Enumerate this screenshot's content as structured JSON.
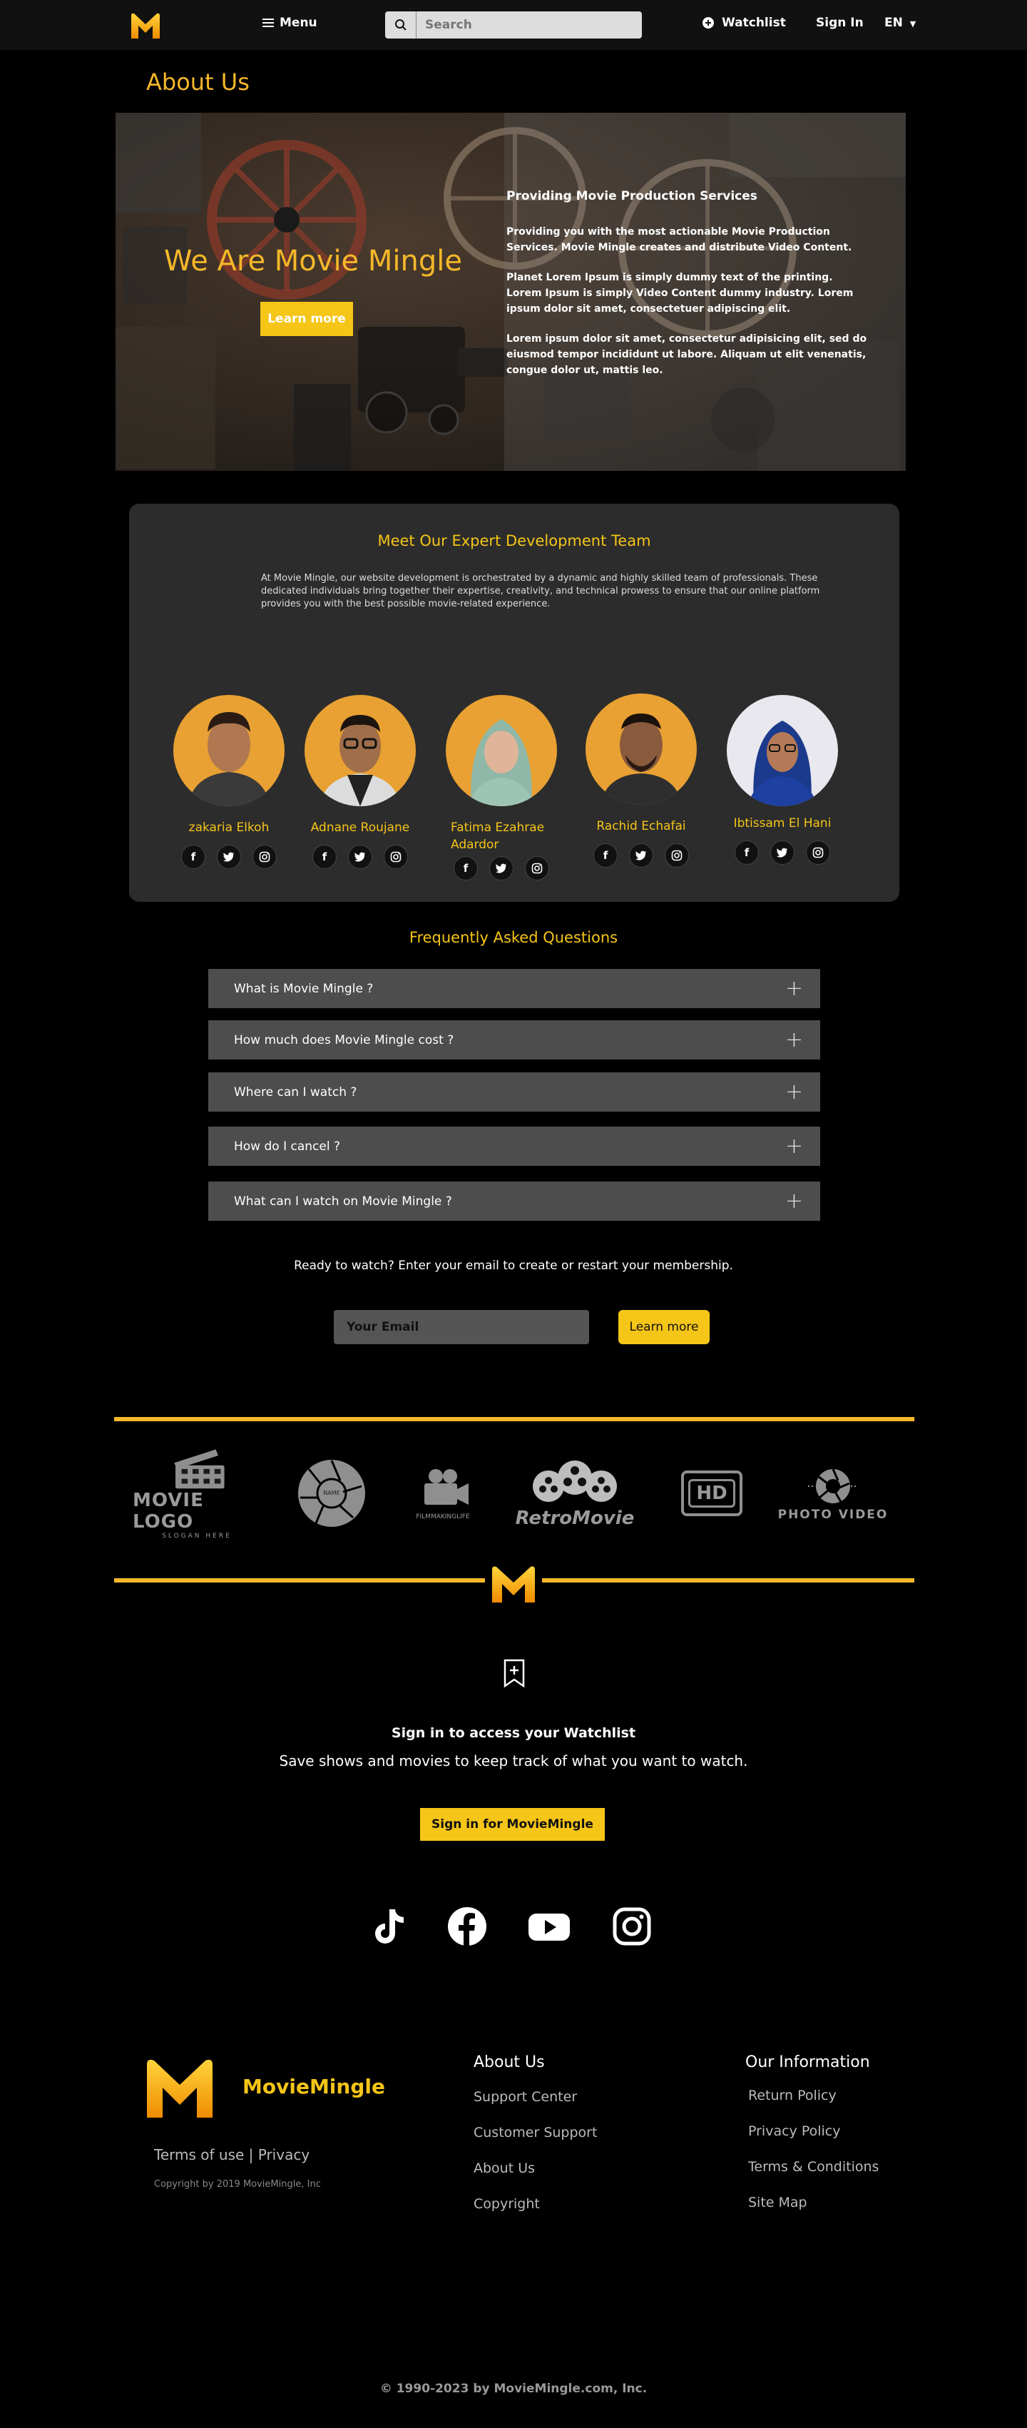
{
  "nav": {
    "menu_label": "Menu",
    "search_placeholder": "Search",
    "watchlist_label": "Watchlist",
    "signin_label": "Sign In",
    "lang_label": "EN"
  },
  "about": {
    "title": "About Us",
    "hero_heading": "We Are Movie Mingle",
    "hero_button": "Learn more",
    "text_title": "Providing Movie Production Services",
    "para1": "Providing you with the most actionable Movie Production Services. Movie Mingle creates and distribute Video Content.",
    "para2": "Planet Lorem Ipsum is simply dummy text of the printing. Lorem Ipsum is simply Video Content dummy industry. Lorem ipsum dolor sit amet, consectetuer adipiscing elit.",
    "para3": "Lorem ipsum dolor sit amet, consectetur adipisicing elit, sed do eiusmod tempor incididunt ut labore. Aliquam ut elit venenatis, congue dolor ut, mattis leo."
  },
  "team": {
    "title": "Meet Our Expert Development Team",
    "description": "At Movie Mingle, our website development is orchestrated by a dynamic and highly skilled team of professionals. These dedicated individuals bring together their expertise, creativity, and technical prowess to ensure that our online platform provides you with the best possible movie-related experience.",
    "members": [
      {
        "name": "zakaria Elkoh"
      },
      {
        "name": "Adnane Roujane"
      },
      {
        "name": "Fatima Ezahrae Adardor"
      },
      {
        "name": "Rachid Echafai"
      },
      {
        "name": "Ibtissam El Hani"
      }
    ]
  },
  "faq": {
    "title": "Frequently Asked Questions",
    "items": [
      {
        "q": "What is Movie Mingle ?"
      },
      {
        "q": "How much does Movie Mingle cost ?"
      },
      {
        "q": "Where can I watch ?"
      },
      {
        "q": "How do I cancel ?"
      },
      {
        "q": "What can I watch on Movie Mingle ?"
      }
    ]
  },
  "signup": {
    "prompt": "Ready to watch? Enter your email to create or restart your membership.",
    "email_placeholder": "Your Email",
    "button": "Learn more"
  },
  "brands": {
    "movie_logo": "MOVIE LOGO",
    "movie_logo_slogan": "SLOGAN HERE",
    "name_badge": "NAME",
    "filmmaking": "FILMMAKINGLIFE",
    "retro": "RetroMovie",
    "hd": "HD",
    "photo_video": "PHOTO VIDEO"
  },
  "watchlist": {
    "heading": "Sign in to access your Watchlist",
    "subheading": "Save shows and movies to keep track of what you want to watch.",
    "button": "Sign in for  MovieMingle"
  },
  "footer": {
    "brand": "MovieMingle",
    "terms": "Terms of use | Privacy",
    "copyright_small": "Copyright by 2019 MovieMingle, Inc",
    "col1_title": "About Us",
    "col1_links": [
      "Support Center",
      "Customer Support",
      "About Us",
      "Copyright"
    ],
    "col2_title": "Our Information",
    "col2_links": [
      "Return Policy",
      "Privacy Policy",
      "Terms & Conditions",
      "Site Map"
    ],
    "bottom": "© 1990-2023 by MovieMingle.com, Inc."
  },
  "colors": {
    "accent": "#f5c518",
    "accent_text": "#f5b82a",
    "panel": "#2c2c2c",
    "faq_bar": "#4d4d4d"
  }
}
